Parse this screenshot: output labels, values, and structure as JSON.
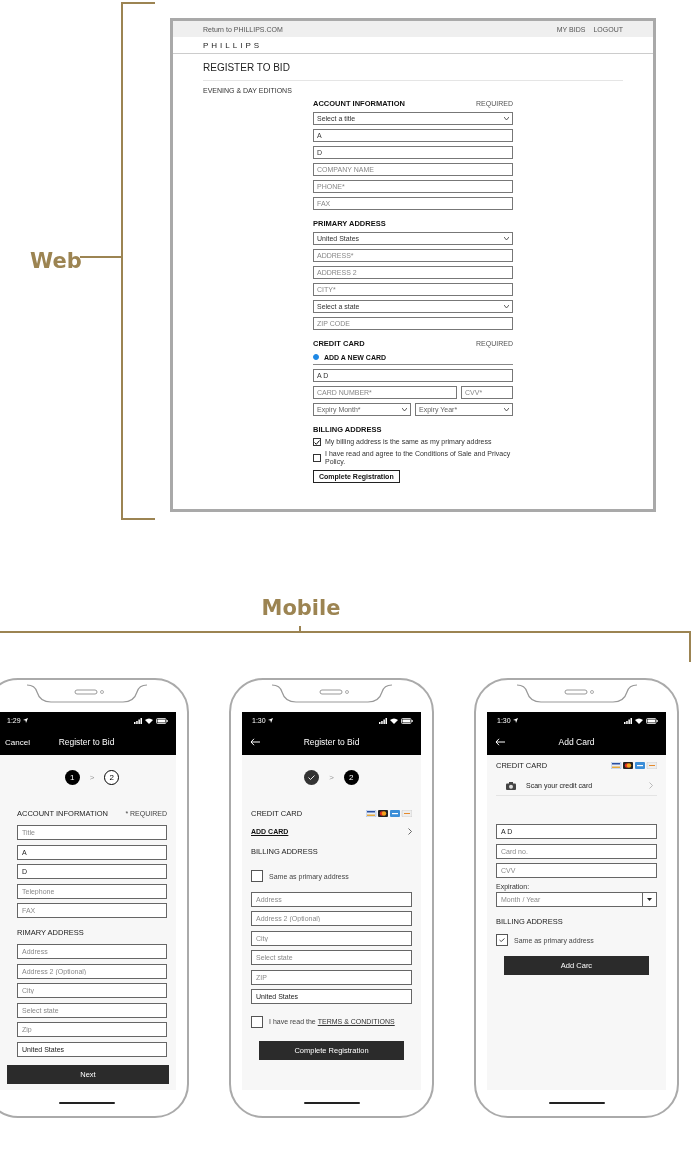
{
  "labels": {
    "web": "Web",
    "mobile": "Mobile"
  },
  "web": {
    "top_bar": {
      "link": "Return to PHILLIPS.COM",
      "actions": [
        "MY BIDS",
        "LOGOUT"
      ]
    },
    "logo": "PHILLIPS",
    "title": "REGISTER TO BID",
    "sale": "EVENING & DAY EDITIONS",
    "sections": [
      {
        "title": "ACCOUNT INFORMATION",
        "note": "REQUIRED",
        "fields": [
          {
            "kind": "select",
            "value": "Select a title"
          },
          {
            "kind": "input",
            "value": "A"
          },
          {
            "kind": "input",
            "value": "D"
          },
          {
            "kind": "input",
            "placeholder": "COMPANY NAME"
          },
          {
            "kind": "input",
            "placeholder": "PHONE*"
          },
          {
            "kind": "input",
            "placeholder": "FAX"
          }
        ]
      },
      {
        "title": "PRIMARY ADDRESS",
        "fields": [
          {
            "kind": "select",
            "value": "United States"
          },
          {
            "kind": "input",
            "placeholder": "ADDRESS*"
          },
          {
            "kind": "input",
            "placeholder": "ADDRESS 2"
          },
          {
            "kind": "input",
            "placeholder": "CITY*"
          },
          {
            "kind": "select",
            "value": "Select a state"
          },
          {
            "kind": "input",
            "placeholder": "ZIP CODE"
          }
        ]
      },
      {
        "title": "CREDIT CARD",
        "note": "REQUIRED",
        "fields": [
          {
            "kind": "radio",
            "label": "ADD A NEW CARD",
            "selected": true
          },
          {
            "kind": "input",
            "value": "A D"
          },
          {
            "kind": "pair",
            "fields": [
              {
                "kind": "input",
                "placeholder": "CARD NUMBER*"
              },
              {
                "kind": "input",
                "placeholder": "CVV*"
              }
            ]
          },
          {
            "kind": "pair",
            "fields": [
              {
                "kind": "select",
                "placeholder": "Expiry Month*"
              },
              {
                "kind": "select",
                "placeholder": "Expiry Year*"
              }
            ]
          }
        ]
      },
      {
        "title": "BILLING ADDRESS",
        "fields": [
          {
            "kind": "checkbox",
            "label": "My billing address is the same as my primary address",
            "checked": true
          },
          {
            "kind": "checkbox",
            "label": "I have read and agree to the Conditions of Sale and Privacy Policy.",
            "checked": false
          },
          {
            "kind": "button",
            "label": "Complete Registration"
          }
        ]
      }
    ]
  },
  "mobile": {
    "phones": [
      {
        "time": "1:29",
        "nav_left": {
          "kind": "text",
          "label": "Cancel"
        },
        "title": "Register to Bid",
        "blocks": [
          {
            "kind": "stepper",
            "separator": ">",
            "steps": [
              {
                "label": "1",
                "current": true,
                "done": false
              },
              {
                "label": "2",
                "current": false,
                "done": false
              }
            ]
          },
          {
            "kind": "section",
            "title": "ACCOUNT INFORMATION",
            "note": "* REQUIRED"
          },
          {
            "kind": "input",
            "placeholder": "Title"
          },
          {
            "kind": "input",
            "value": "A"
          },
          {
            "kind": "input",
            "value": "D"
          },
          {
            "kind": "input",
            "placeholder": "Telephone"
          },
          {
            "kind": "input",
            "placeholder": "FAX"
          },
          {
            "kind": "section",
            "title": "RIMARY ADDRESS"
          },
          {
            "kind": "input",
            "placeholder": "Address"
          },
          {
            "kind": "input",
            "placeholder": "Address 2 (Optional)"
          },
          {
            "kind": "input",
            "placeholder": "City"
          },
          {
            "kind": "input",
            "placeholder": "Select state"
          },
          {
            "kind": "input",
            "placeholder": "Zip"
          },
          {
            "kind": "input",
            "value": "United States"
          },
          {
            "kind": "button",
            "label": "Next"
          }
        ]
      },
      {
        "time": "1:30",
        "nav_left": {
          "kind": "back"
        },
        "title": "Register to Bid",
        "blocks": [
          {
            "kind": "stepper",
            "separator": ">",
            "steps": [
              {
                "current": false,
                "done": true
              },
              {
                "label": "2",
                "current": true,
                "done": false
              }
            ]
          },
          {
            "kind": "section",
            "title": "CREDIT CARD",
            "card_logos": true
          },
          {
            "kind": "link_row",
            "label": "ADD CARD"
          },
          {
            "kind": "section",
            "title": "BILLING ADDRESS"
          },
          {
            "kind": "checkbox",
            "label": "Same as primary address",
            "checked": false
          },
          {
            "kind": "input",
            "placeholder": "Address"
          },
          {
            "kind": "input",
            "placeholder": "Address 2 (Optional)"
          },
          {
            "kind": "input",
            "placeholder": "City"
          },
          {
            "kind": "input",
            "placeholder": "Select state"
          },
          {
            "kind": "input",
            "placeholder": "ZIP"
          },
          {
            "kind": "input",
            "value": "United States"
          },
          {
            "kind": "checkbox",
            "label": "I have read the",
            "link": "TERMS & CONDITIONS",
            "checked": false
          },
          {
            "kind": "button",
            "label": "Complete Registration"
          }
        ]
      },
      {
        "time": "1:30",
        "nav_left": {
          "kind": "back"
        },
        "title": "Add Card",
        "blocks": [
          {
            "kind": "section",
            "title": "CREDIT CARD",
            "card_logos": true
          },
          {
            "kind": "scan_row",
            "label": "Scan your credit card"
          },
          {
            "kind": "input",
            "value": "A D"
          },
          {
            "kind": "input",
            "placeholder": "Card no."
          },
          {
            "kind": "input",
            "placeholder": "CVV"
          },
          {
            "kind": "label",
            "label": "Expiration:"
          },
          {
            "kind": "select",
            "placeholder": "Month / Year"
          },
          {
            "kind": "section",
            "title": "BILLING ADDRESS"
          },
          {
            "kind": "checkbox",
            "label": "Same as primary address",
            "checked": true
          },
          {
            "kind": "button",
            "label": "Add Carc"
          }
        ]
      }
    ]
  }
}
